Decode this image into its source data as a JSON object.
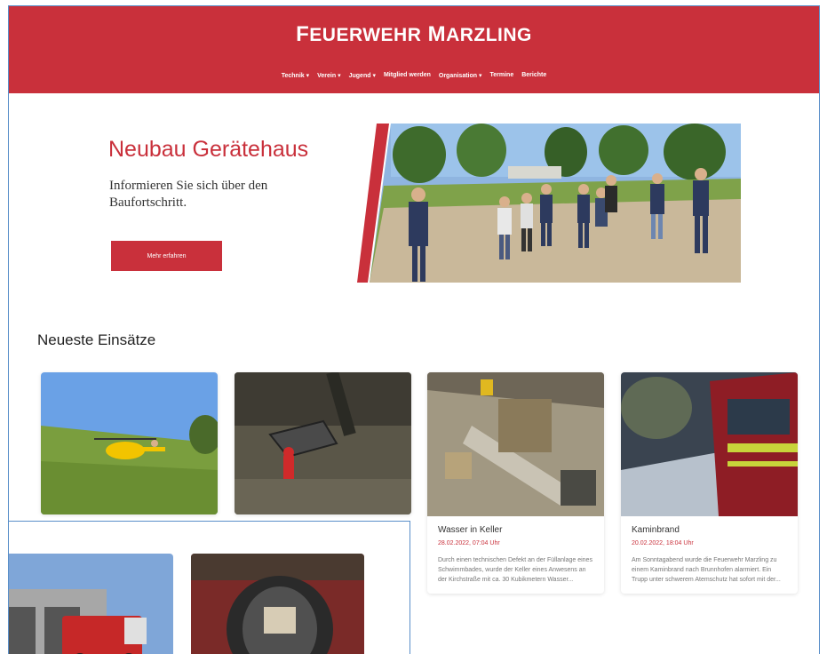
{
  "header": {
    "title_first_letter_1": "F",
    "title_rest_1": "EUERWEHR",
    "title_first_letter_2": "M",
    "title_rest_2": "ARZLING",
    "nav": [
      "Technik ▾",
      "Verein ▾",
      "Jugend ▾",
      "Mitglied werden",
      "Organisation ▾",
      "Termine",
      "Berichte"
    ]
  },
  "hero": {
    "title": "Neubau Gerätehaus",
    "subtitle": "Informieren Sie sich über den Baufortschritt.",
    "button": "Mehr erfahren"
  },
  "section": {
    "title": "Neueste Einsätze"
  },
  "cards": [
    {
      "title": "Wasser in Keller",
      "date": "28.02.2022, 07:04 Uhr",
      "text": "Durch einen technischen Defekt an der Füllanlage eines Schwimmbades, wurde der Keller eines Anwesens an der Kirchstraße mit ca. 30 Kubikmetern Wasser..."
    },
    {
      "title": "Kaminbrand",
      "date": "20.02.2022, 18:04 Uhr",
      "text": "Am Sonntagabend wurde die Feuerwehr Marzling zu einem Kaminbrand nach Brunnhofen alarmiert. Ein Trupp unter schwerem Atemschutz hat sofort mit der..."
    }
  ],
  "colors": {
    "brand": "#c9303b",
    "overlay_border": "#5a8fc9"
  }
}
